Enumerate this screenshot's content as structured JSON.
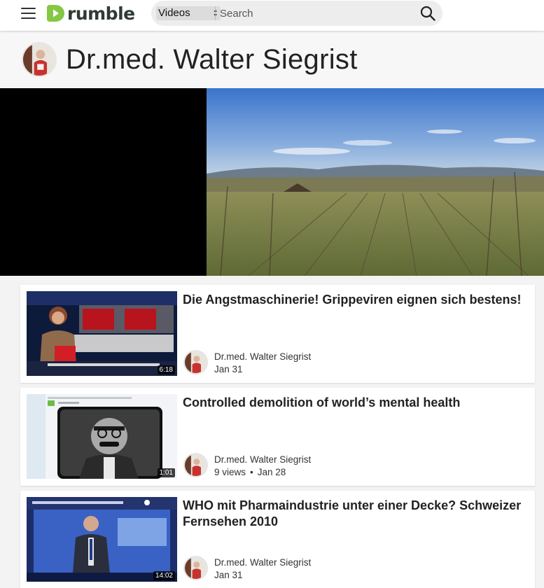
{
  "header": {
    "logo_text": "rumble",
    "search_scope": "Videos",
    "search_placeholder": "Search"
  },
  "channel": {
    "name": "Dr.med. Walter Siegrist"
  },
  "videos": [
    {
      "title": "Die Angstmaschinerie! Grippeviren eignen sich bestens!",
      "duration": "6:18",
      "author": "Dr.med. Walter Siegrist",
      "views": "",
      "date": "Jan 31"
    },
    {
      "title": "Controlled demolition of world’s mental health",
      "duration": "1:01",
      "author": "Dr.med. Walter Siegrist",
      "views": "9 views",
      "date": "Jan 28"
    },
    {
      "title": "WHO mit Pharmaindustrie unter einer Decke? Schweizer Fernsehen 2010",
      "duration": "14:02",
      "author": "Dr.med. Walter Siegrist",
      "views": "",
      "date": "Jan 31"
    }
  ],
  "colors": {
    "brand": "#85c742",
    "background": "#f3f3f3"
  }
}
